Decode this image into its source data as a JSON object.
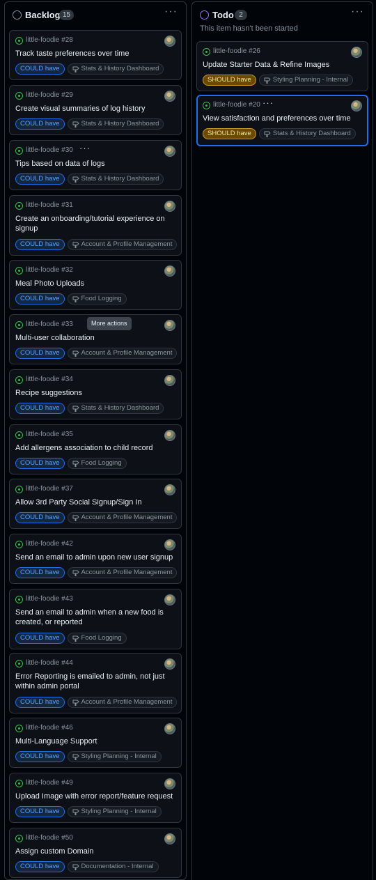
{
  "columns": {
    "backlog": {
      "title": "Backlog",
      "count": "15"
    },
    "todo": {
      "title": "Todo",
      "count": "2",
      "description": "This item hasn't been started"
    }
  },
  "menu_glyph": "···",
  "tooltip": "More actions",
  "priority_labels": {
    "could": "COULD have",
    "should": "SHOULD have"
  },
  "backlog_cards": [
    {
      "ref": "little-foodie #28",
      "title": "Track taste preferences over time",
      "priority": "COULD have",
      "milestone": "Stats & History Dashboard"
    },
    {
      "ref": "little-foodie #29",
      "title": "Create visual summaries of log history",
      "priority": "COULD have",
      "milestone": "Stats & History Dashboard"
    },
    {
      "ref": "little-foodie #30",
      "title": "Tips based on data of logs",
      "priority": "COULD have",
      "milestone": "Stats & History Dashboard"
    },
    {
      "ref": "little-foodie #31",
      "title": "Create an onboarding/tutorial experience on signup",
      "priority": "COULD have",
      "milestone": "Account & Profile Management"
    },
    {
      "ref": "little-foodie #32",
      "title": "Meal Photo Uploads",
      "priority": "COULD have",
      "milestone": "Food Logging"
    },
    {
      "ref": "little-foodie #33",
      "title": "Multi-user collaboration",
      "priority": "COULD have",
      "milestone": "Account & Profile Management"
    },
    {
      "ref": "little-foodie #34",
      "title": "Recipe suggestions",
      "priority": "COULD have",
      "milestone": "Stats & History Dashboard"
    },
    {
      "ref": "little-foodie #35",
      "title": "Add allergens association to child record",
      "priority": "COULD have",
      "milestone": "Food Logging"
    },
    {
      "ref": "little-foodie #37",
      "title": "Allow 3rd Party Social Signup/Sign In",
      "priority": "COULD have",
      "milestone": "Account & Profile Management"
    },
    {
      "ref": "little-foodie #42",
      "title": "Send an email to admin upon new user signup",
      "priority": "COULD have",
      "milestone": "Account & Profile Management"
    },
    {
      "ref": "little-foodie #43",
      "title": "Send an email to admin when a new food is created, or reported",
      "priority": "COULD have",
      "milestone": "Food Logging"
    },
    {
      "ref": "little-foodie #44",
      "title": "Error Reporting is emailed to admin, not just within admin portal",
      "priority": "COULD have",
      "milestone": "Account & Profile Management"
    },
    {
      "ref": "little-foodie #46",
      "title": "Multi-Language Support",
      "priority": "COULD have",
      "milestone": "Styling Planning - Internal"
    },
    {
      "ref": "little-foodie #49",
      "title": "Upload Image with error report/feature request",
      "priority": "COULD have",
      "milestone": "Styling Planning - Internal"
    },
    {
      "ref": "little-foodie #50",
      "title": "Assign custom Domain",
      "priority": "COULD have",
      "milestone": "Documentation - Internal"
    }
  ],
  "todo_cards": [
    {
      "ref": "little-foodie #26",
      "title": "Update Starter Data & Refine Images",
      "priority": "SHOULD have",
      "milestone": "Styling Planning - Internal"
    },
    {
      "ref": "little-foodie #20",
      "title": "View satisfaction and preferences over time",
      "priority": "SHOULD have",
      "milestone": "Stats & History Dashboard"
    }
  ],
  "colors": {
    "accent": "#1f6feb",
    "open_issue": "#3fb950",
    "todo_status": "#a371f7",
    "should_badge": "#d29922"
  },
  "icons": {
    "issue": "issue-opened-icon",
    "milestone": "milestone-icon",
    "kebab": "kebab-horizontal-icon",
    "status": "circle-status-icon"
  }
}
